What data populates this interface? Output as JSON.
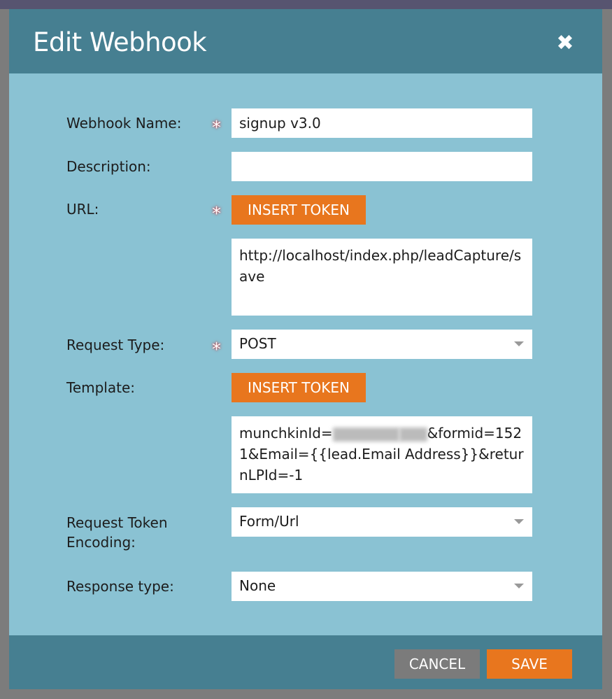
{
  "dialog": {
    "title": "Edit Webhook",
    "close_icon": "close-icon"
  },
  "form": {
    "webhook_name": {
      "label": "Webhook Name:",
      "value": "signup v3.0",
      "required": true
    },
    "description": {
      "label": "Description:",
      "value": ""
    },
    "url": {
      "label": "URL:",
      "insert_token": "INSERT TOKEN",
      "value": "http://localhost/index.php/leadCapture/save",
      "required": true
    },
    "request_type": {
      "label": "Request Type:",
      "value": "POST",
      "required": true
    },
    "template": {
      "label": "Template:",
      "insert_token": "INSERT TOKEN",
      "value_part1": "munchkinId=",
      "value_part2": "&formid=1521&Email={{lead.Email Address}}&returnLPId=-1"
    },
    "request_token_encoding": {
      "label": "Request Token Encoding:",
      "value": "Form/Url"
    },
    "response_type": {
      "label": "Response type:",
      "value": "None"
    }
  },
  "footer": {
    "cancel": "CANCEL",
    "save": "SAVE"
  },
  "colors": {
    "header": "#467f91",
    "body": "#8ac2d3",
    "accent": "#e8761e"
  }
}
